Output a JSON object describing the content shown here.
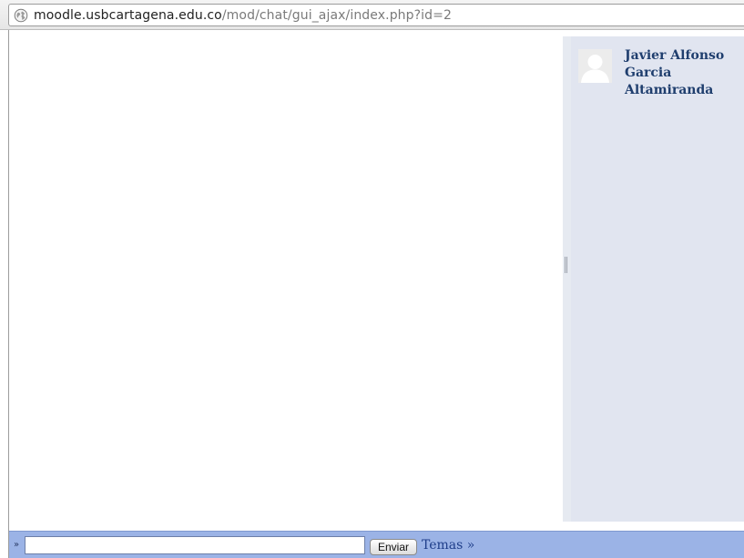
{
  "address_bar": {
    "url_host": "moodle.usbcartagena.edu.co",
    "url_path": "/mod/chat/gui_ajax/index.php?id=2",
    "icon": "globe-icon"
  },
  "users_panel": {
    "users": [
      {
        "name": "Javier Alfonso Garcia Altamiranda",
        "icon": "user-avatar-icon"
      }
    ]
  },
  "input_bar": {
    "prefix": "»",
    "message_value": "",
    "send_label": "Enviar",
    "temas_label": "Temas »"
  },
  "colors": {
    "users_panel_bg": "#e1e5f0",
    "input_bar_bg": "#9bb3e6",
    "user_name": "#1f3e6e"
  }
}
